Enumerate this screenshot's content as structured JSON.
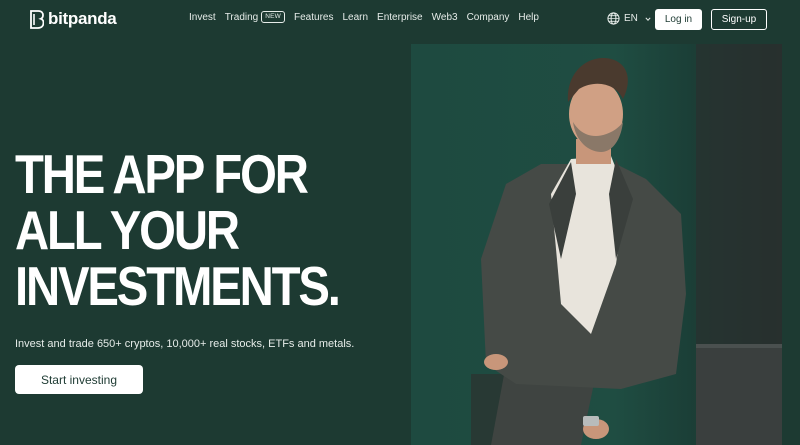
{
  "brand": {
    "name": "bitpanda"
  },
  "nav": {
    "items": [
      {
        "label": "Invest"
      },
      {
        "label": "Trading",
        "badge": "NEW"
      },
      {
        "label": "Features"
      },
      {
        "label": "Learn"
      },
      {
        "label": "Enterprise"
      },
      {
        "label": "Web3"
      },
      {
        "label": "Company"
      },
      {
        "label": "Help"
      }
    ],
    "language": "EN",
    "login_label": "Log in",
    "signup_label": "Sign-up"
  },
  "hero": {
    "headline_lines": [
      "THE APP FOR",
      "ALL YOUR",
      "INVESTMENTS."
    ],
    "subtitle": "Invest and trade 650+ cryptos, 10,000+ real stocks, ETFs and metals.",
    "cta_label": "Start investing"
  },
  "colors": {
    "background": "#1d3a32",
    "text": "#ffffff",
    "button_text": "#1d3a32"
  },
  "icons": {
    "logo": "bitpanda-logo-icon",
    "language": "globe-icon",
    "dropdown": "chevron-down-icon"
  }
}
